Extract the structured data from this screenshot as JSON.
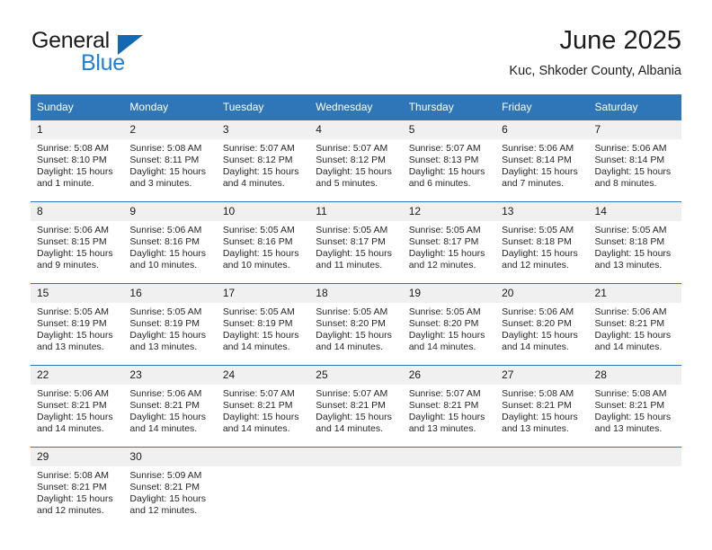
{
  "brand": {
    "name_top": "General",
    "name_bottom": "Blue",
    "triangle_color": "#1268b3",
    "blue_color": "#1e7fd4"
  },
  "header": {
    "month_title": "June 2025",
    "location": "Kuc, Shkoder County, Albania"
  },
  "theme": {
    "header_bar_color": "#2f76b8",
    "daynum_bg": "#f0f0f0",
    "row_divider": "#2f76b8"
  },
  "calendar": {
    "weekday_headers": [
      "Sunday",
      "Monday",
      "Tuesday",
      "Wednesday",
      "Thursday",
      "Friday",
      "Saturday"
    ],
    "labels": {
      "sunrise": "Sunrise:",
      "sunset": "Sunset:",
      "daylight": "Daylight:"
    },
    "weeks": [
      [
        {
          "day": "1",
          "sunrise": "Sunrise: 5:08 AM",
          "sunset": "Sunset: 8:10 PM",
          "daylight_1": "Daylight: 15 hours",
          "daylight_2": "and 1 minute."
        },
        {
          "day": "2",
          "sunrise": "Sunrise: 5:08 AM",
          "sunset": "Sunset: 8:11 PM",
          "daylight_1": "Daylight: 15 hours",
          "daylight_2": "and 3 minutes."
        },
        {
          "day": "3",
          "sunrise": "Sunrise: 5:07 AM",
          "sunset": "Sunset: 8:12 PM",
          "daylight_1": "Daylight: 15 hours",
          "daylight_2": "and 4 minutes."
        },
        {
          "day": "4",
          "sunrise": "Sunrise: 5:07 AM",
          "sunset": "Sunset: 8:12 PM",
          "daylight_1": "Daylight: 15 hours",
          "daylight_2": "and 5 minutes."
        },
        {
          "day": "5",
          "sunrise": "Sunrise: 5:07 AM",
          "sunset": "Sunset: 8:13 PM",
          "daylight_1": "Daylight: 15 hours",
          "daylight_2": "and 6 minutes."
        },
        {
          "day": "6",
          "sunrise": "Sunrise: 5:06 AM",
          "sunset": "Sunset: 8:14 PM",
          "daylight_1": "Daylight: 15 hours",
          "daylight_2": "and 7 minutes."
        },
        {
          "day": "7",
          "sunrise": "Sunrise: 5:06 AM",
          "sunset": "Sunset: 8:14 PM",
          "daylight_1": "Daylight: 15 hours",
          "daylight_2": "and 8 minutes."
        }
      ],
      [
        {
          "day": "8",
          "sunrise": "Sunrise: 5:06 AM",
          "sunset": "Sunset: 8:15 PM",
          "daylight_1": "Daylight: 15 hours",
          "daylight_2": "and 9 minutes."
        },
        {
          "day": "9",
          "sunrise": "Sunrise: 5:06 AM",
          "sunset": "Sunset: 8:16 PM",
          "daylight_1": "Daylight: 15 hours",
          "daylight_2": "and 10 minutes."
        },
        {
          "day": "10",
          "sunrise": "Sunrise: 5:05 AM",
          "sunset": "Sunset: 8:16 PM",
          "daylight_1": "Daylight: 15 hours",
          "daylight_2": "and 10 minutes."
        },
        {
          "day": "11",
          "sunrise": "Sunrise: 5:05 AM",
          "sunset": "Sunset: 8:17 PM",
          "daylight_1": "Daylight: 15 hours",
          "daylight_2": "and 11 minutes."
        },
        {
          "day": "12",
          "sunrise": "Sunrise: 5:05 AM",
          "sunset": "Sunset: 8:17 PM",
          "daylight_1": "Daylight: 15 hours",
          "daylight_2": "and 12 minutes."
        },
        {
          "day": "13",
          "sunrise": "Sunrise: 5:05 AM",
          "sunset": "Sunset: 8:18 PM",
          "daylight_1": "Daylight: 15 hours",
          "daylight_2": "and 12 minutes."
        },
        {
          "day": "14",
          "sunrise": "Sunrise: 5:05 AM",
          "sunset": "Sunset: 8:18 PM",
          "daylight_1": "Daylight: 15 hours",
          "daylight_2": "and 13 minutes."
        }
      ],
      [
        {
          "day": "15",
          "sunrise": "Sunrise: 5:05 AM",
          "sunset": "Sunset: 8:19 PM",
          "daylight_1": "Daylight: 15 hours",
          "daylight_2": "and 13 minutes."
        },
        {
          "day": "16",
          "sunrise": "Sunrise: 5:05 AM",
          "sunset": "Sunset: 8:19 PM",
          "daylight_1": "Daylight: 15 hours",
          "daylight_2": "and 13 minutes."
        },
        {
          "day": "17",
          "sunrise": "Sunrise: 5:05 AM",
          "sunset": "Sunset: 8:19 PM",
          "daylight_1": "Daylight: 15 hours",
          "daylight_2": "and 14 minutes."
        },
        {
          "day": "18",
          "sunrise": "Sunrise: 5:05 AM",
          "sunset": "Sunset: 8:20 PM",
          "daylight_1": "Daylight: 15 hours",
          "daylight_2": "and 14 minutes."
        },
        {
          "day": "19",
          "sunrise": "Sunrise: 5:05 AM",
          "sunset": "Sunset: 8:20 PM",
          "daylight_1": "Daylight: 15 hours",
          "daylight_2": "and 14 minutes."
        },
        {
          "day": "20",
          "sunrise": "Sunrise: 5:06 AM",
          "sunset": "Sunset: 8:20 PM",
          "daylight_1": "Daylight: 15 hours",
          "daylight_2": "and 14 minutes."
        },
        {
          "day": "21",
          "sunrise": "Sunrise: 5:06 AM",
          "sunset": "Sunset: 8:21 PM",
          "daylight_1": "Daylight: 15 hours",
          "daylight_2": "and 14 minutes."
        }
      ],
      [
        {
          "day": "22",
          "sunrise": "Sunrise: 5:06 AM",
          "sunset": "Sunset: 8:21 PM",
          "daylight_1": "Daylight: 15 hours",
          "daylight_2": "and 14 minutes."
        },
        {
          "day": "23",
          "sunrise": "Sunrise: 5:06 AM",
          "sunset": "Sunset: 8:21 PM",
          "daylight_1": "Daylight: 15 hours",
          "daylight_2": "and 14 minutes."
        },
        {
          "day": "24",
          "sunrise": "Sunrise: 5:07 AM",
          "sunset": "Sunset: 8:21 PM",
          "daylight_1": "Daylight: 15 hours",
          "daylight_2": "and 14 minutes."
        },
        {
          "day": "25",
          "sunrise": "Sunrise: 5:07 AM",
          "sunset": "Sunset: 8:21 PM",
          "daylight_1": "Daylight: 15 hours",
          "daylight_2": "and 14 minutes."
        },
        {
          "day": "26",
          "sunrise": "Sunrise: 5:07 AM",
          "sunset": "Sunset: 8:21 PM",
          "daylight_1": "Daylight: 15 hours",
          "daylight_2": "and 13 minutes."
        },
        {
          "day": "27",
          "sunrise": "Sunrise: 5:08 AM",
          "sunset": "Sunset: 8:21 PM",
          "daylight_1": "Daylight: 15 hours",
          "daylight_2": "and 13 minutes."
        },
        {
          "day": "28",
          "sunrise": "Sunrise: 5:08 AM",
          "sunset": "Sunset: 8:21 PM",
          "daylight_1": "Daylight: 15 hours",
          "daylight_2": "and 13 minutes."
        }
      ],
      [
        {
          "day": "29",
          "sunrise": "Sunrise: 5:08 AM",
          "sunset": "Sunset: 8:21 PM",
          "daylight_1": "Daylight: 15 hours",
          "daylight_2": "and 12 minutes."
        },
        {
          "day": "30",
          "sunrise": "Sunrise: 5:09 AM",
          "sunset": "Sunset: 8:21 PM",
          "daylight_1": "Daylight: 15 hours",
          "daylight_2": "and 12 minutes."
        },
        {
          "day": "",
          "sunrise": "",
          "sunset": "",
          "daylight_1": "",
          "daylight_2": ""
        },
        {
          "day": "",
          "sunrise": "",
          "sunset": "",
          "daylight_1": "",
          "daylight_2": ""
        },
        {
          "day": "",
          "sunrise": "",
          "sunset": "",
          "daylight_1": "",
          "daylight_2": ""
        },
        {
          "day": "",
          "sunrise": "",
          "sunset": "",
          "daylight_1": "",
          "daylight_2": ""
        },
        {
          "day": "",
          "sunrise": "",
          "sunset": "",
          "daylight_1": "",
          "daylight_2": ""
        }
      ]
    ]
  }
}
